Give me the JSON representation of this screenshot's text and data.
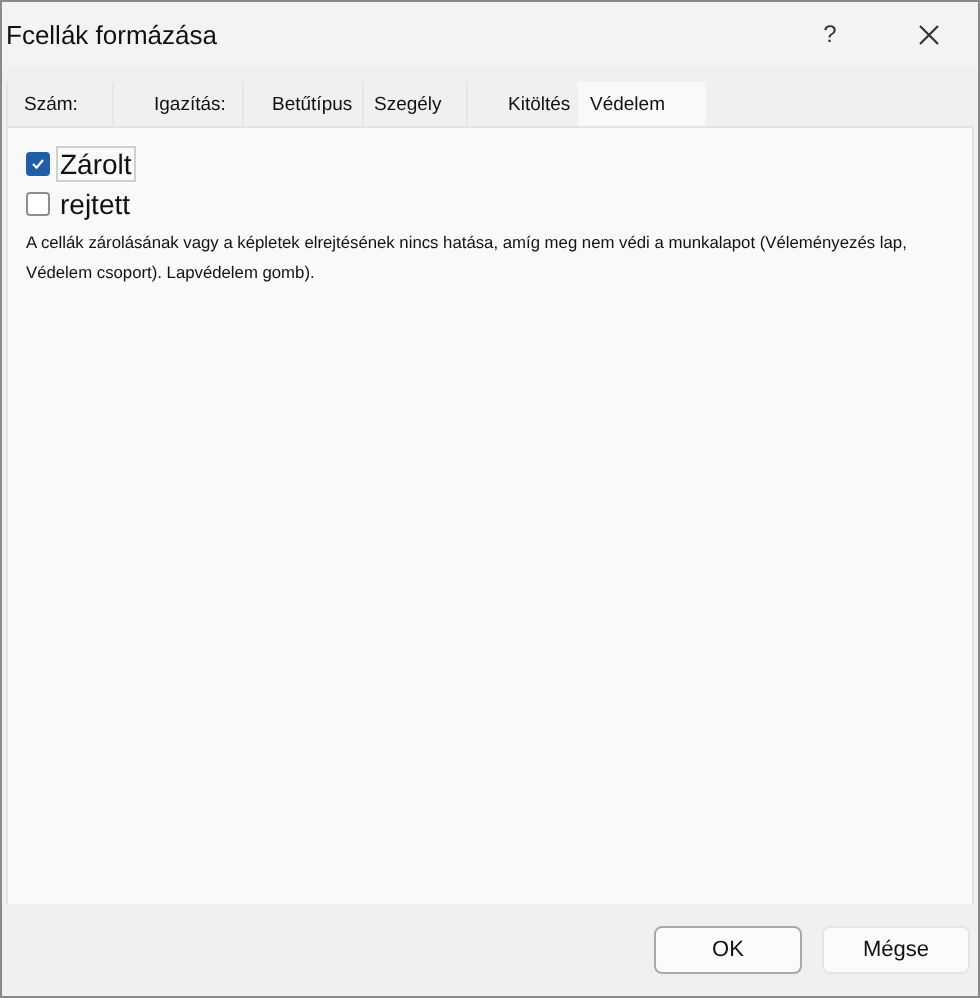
{
  "window": {
    "title": "Fcellák formázása",
    "help": "?"
  },
  "tabs": [
    {
      "label": "Szám:",
      "selected": false
    },
    {
      "label": "Igazítás:",
      "selected": false
    },
    {
      "label": "Betűtípus",
      "selected": false
    },
    {
      "label": "Szegély",
      "selected": false
    },
    {
      "label": "Kitöltés",
      "selected": false
    },
    {
      "label": "Védelem",
      "selected": true
    }
  ],
  "options": [
    {
      "label": "Zárolt",
      "checked": true,
      "focused": true
    },
    {
      "label": "rejtett",
      "checked": false,
      "focused": false
    }
  ],
  "note": "A cellák zárolásának vagy a képletek elrejtésének nincs hatása, amíg meg nem védi a munkalapot (Véleményezés lap, Védelem csoport). Lapvédelem gomb).",
  "buttons": [
    "OK",
    "Mégse"
  ]
}
